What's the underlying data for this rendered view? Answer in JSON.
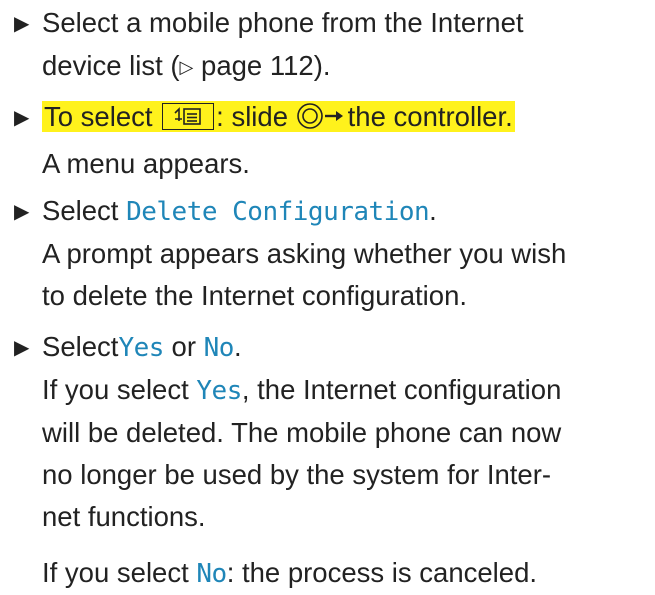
{
  "steps": [
    {
      "lines": [
        "Select a mobile phone from the Internet",
        "device list ("
      ],
      "ref_page": "page 112",
      "ref_close": ")."
    },
    {
      "prefix": "To select",
      "middle": ": slide",
      "suffix": "the controller.",
      "result": "A menu appears.",
      "icons": {
        "soft_key": "menu-list-icon",
        "controller": "controller-slide-right-icon"
      }
    },
    {
      "prefix": "Select ",
      "menu_item": "Delete Configuration",
      "suffix": ".",
      "result_lines": [
        "A prompt appears asking whether you wish",
        "to delete the Internet configuration."
      ]
    },
    {
      "prefix": "Select",
      "option_yes": "Yes",
      "or": " or ",
      "option_no": "No",
      "suffix": ".",
      "yes_result": {
        "prefix": "If you select ",
        "option": "Yes",
        "line1_rest": ", the Internet configuration",
        "more_lines": [
          "will be deleted. The mobile phone can now",
          "no longer be used by the system for Inter-",
          "net functions."
        ]
      },
      "no_result": {
        "prefix": "If you select ",
        "option": "No",
        "rest": ": the process is canceled."
      }
    }
  ],
  "colors": {
    "ui_text": "#1f86b8",
    "highlight": "#fff21c",
    "body_text": "#222222"
  }
}
